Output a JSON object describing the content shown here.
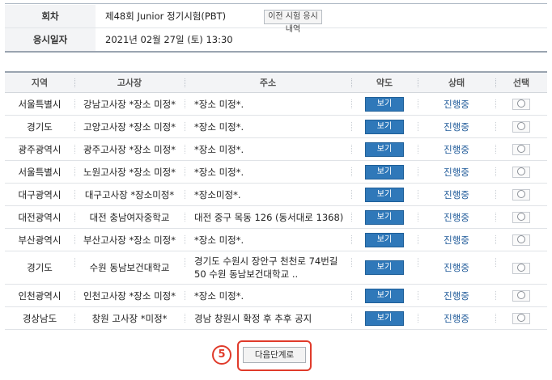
{
  "info": {
    "session_label": "회차",
    "session_value": "제48회 Junior 정기시험(PBT)",
    "history_button": "이전 시험 응시내역",
    "date_label": "응시일자",
    "date_value": "2021년 02월 27일 (토) 13:30"
  },
  "table": {
    "headers": [
      "지역",
      "고사장",
      "주소",
      "약도",
      "상태",
      "선택"
    ],
    "map_label": "보기",
    "rows": [
      {
        "region": "서울특별시",
        "venue": "강남고사장 *장소 미정*",
        "address": "*장소 미정*.",
        "status": "진행중"
      },
      {
        "region": "경기도",
        "venue": "고양고사장 *장소 미정*",
        "address": "*장소 미정*.",
        "status": "진행중"
      },
      {
        "region": "광주광역시",
        "venue": "광주고사장 *장소 미정*",
        "address": "*장소 미정*.",
        "status": "진행중"
      },
      {
        "region": "서울특별시",
        "venue": "노원고사장 *장소 미정*",
        "address": "*장소 미정*.",
        "status": "진행중"
      },
      {
        "region": "대구광역시",
        "venue": "대구고사장 *장소미정*",
        "address": "*장소미정*.",
        "status": "진행중"
      },
      {
        "region": "대전광역시",
        "venue": "대전 충남여자중학교",
        "address": "대전 중구 목동 126 (동서대로 1368)",
        "status": "진행중"
      },
      {
        "region": "부산광역시",
        "venue": "부산고사장 *장소 미정*",
        "address": "*장소 미정*.",
        "status": "진행중"
      },
      {
        "region": "경기도",
        "venue": "수원 동남보건대학교",
        "address": "경기도 수원시 장안구 천천로 74번길 50 수원 동남보건대학교 ..",
        "status": "진행중"
      },
      {
        "region": "인천광역시",
        "venue": "인천고사장 *장소 미정*",
        "address": "*장소 미정*.",
        "status": "진행중"
      },
      {
        "region": "경상남도",
        "venue": "창원 고사장 *미정*",
        "address": "경남 창원시 확정 후 추후 공지",
        "status": "진행중"
      }
    ]
  },
  "footer": {
    "step_number": "5",
    "next_button": "다음단계로",
    "highlight_color": "#e03b2b"
  }
}
